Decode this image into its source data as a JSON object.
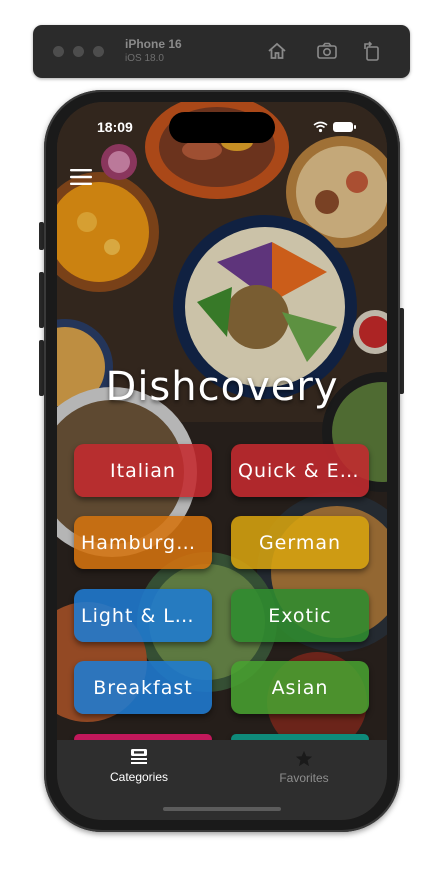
{
  "simulator": {
    "device": "iPhone 16",
    "os": "iOS 18.0",
    "toolbar_icons": [
      "home-icon",
      "screenshot-icon",
      "rotate-icon"
    ]
  },
  "status_bar": {
    "time": "18:09"
  },
  "header": {
    "menu_icon": "hamburger-menu-icon"
  },
  "app": {
    "title": "Dishcovery"
  },
  "categories": [
    {
      "label": "Italian",
      "color": "#c42a2f"
    },
    {
      "label": "Quick & Easy",
      "color": "#c42a2f"
    },
    {
      "label": "Hamburgers",
      "color": "#d4730f"
    },
    {
      "label": "German",
      "color": "#d6a30f"
    },
    {
      "label": "Light & Lovely",
      "color": "#1f7bd1"
    },
    {
      "label": "Exotic",
      "color": "#2f8c2f"
    },
    {
      "label": "Breakfast",
      "color": "#1f7bd1"
    },
    {
      "label": "Asian",
      "color": "#48a030"
    }
  ],
  "tabbar": {
    "tabs": [
      {
        "label": "Categories",
        "icon": "categories-icon",
        "active": true
      },
      {
        "label": "Favorites",
        "icon": "star-icon",
        "active": false
      }
    ]
  }
}
